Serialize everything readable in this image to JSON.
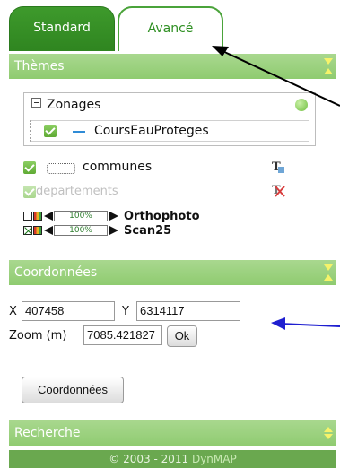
{
  "tabs": {
    "standard": "Standard",
    "avance": "Avancé"
  },
  "themes": {
    "title": "Thèmes",
    "group": {
      "label": "Zonages",
      "child": "CoursEauProteges"
    },
    "layers": [
      {
        "label": "communes"
      },
      {
        "label": "departements"
      }
    ],
    "rasters": [
      {
        "opacity": "100%",
        "label": "Orthophoto"
      },
      {
        "opacity": "100%",
        "label": "Scan25"
      }
    ]
  },
  "coordinates": {
    "title": "Coordonnées",
    "x_label": "X",
    "x_value": "407458",
    "y_label": "Y",
    "y_value": "6314117",
    "zoom_label": "Zoom (m)",
    "zoom_value": "7085.421827",
    "ok_label": "Ok",
    "button_label": "Coordonnées"
  },
  "search": {
    "title": "Recherche"
  },
  "footer": {
    "copyright": "© 2003 - 2011",
    "brand": "DynMAP"
  },
  "colors": {
    "accent": "#8fcb70",
    "tab_active": "#2f8520",
    "annotation_blue": "#1f1fd0"
  }
}
